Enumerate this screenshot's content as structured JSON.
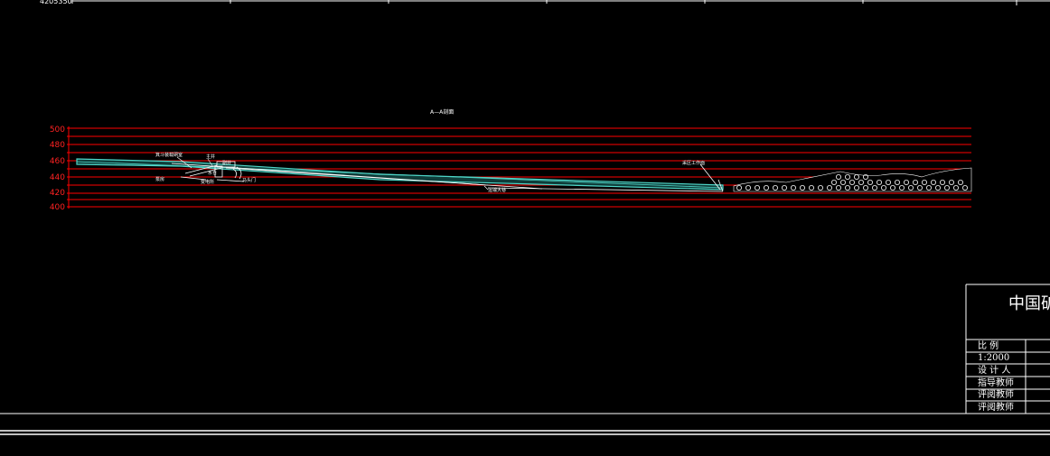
{
  "top_coordinate_label": "4205350",
  "section_title": "A—A剖面",
  "y_axis_ticks": [
    "500",
    "480",
    "460",
    "440",
    "420",
    "400"
  ],
  "annotations": {
    "label_1": "箕斗装载硐室",
    "label_2": "主井",
    "label_3": "副井",
    "label_4": "水仓",
    "label_5": "泵房",
    "label_6": "变电所",
    "label_7": "马头门",
    "label_8": "运输大巷",
    "label_9": "采区工作面"
  },
  "title_block": {
    "school": "中国矿",
    "scale_header": "比  例",
    "scale_value": "1:2000",
    "designer": "设 计 人",
    "advisor": "指导教师",
    "reviewer_1": "评阅教师",
    "reviewer_2": "评阅教师"
  },
  "colors": {
    "background": "#000000",
    "grid_red": "#ff0000",
    "seam_cyan": "#4fd6c8",
    "lines_white": "#ffffff"
  }
}
